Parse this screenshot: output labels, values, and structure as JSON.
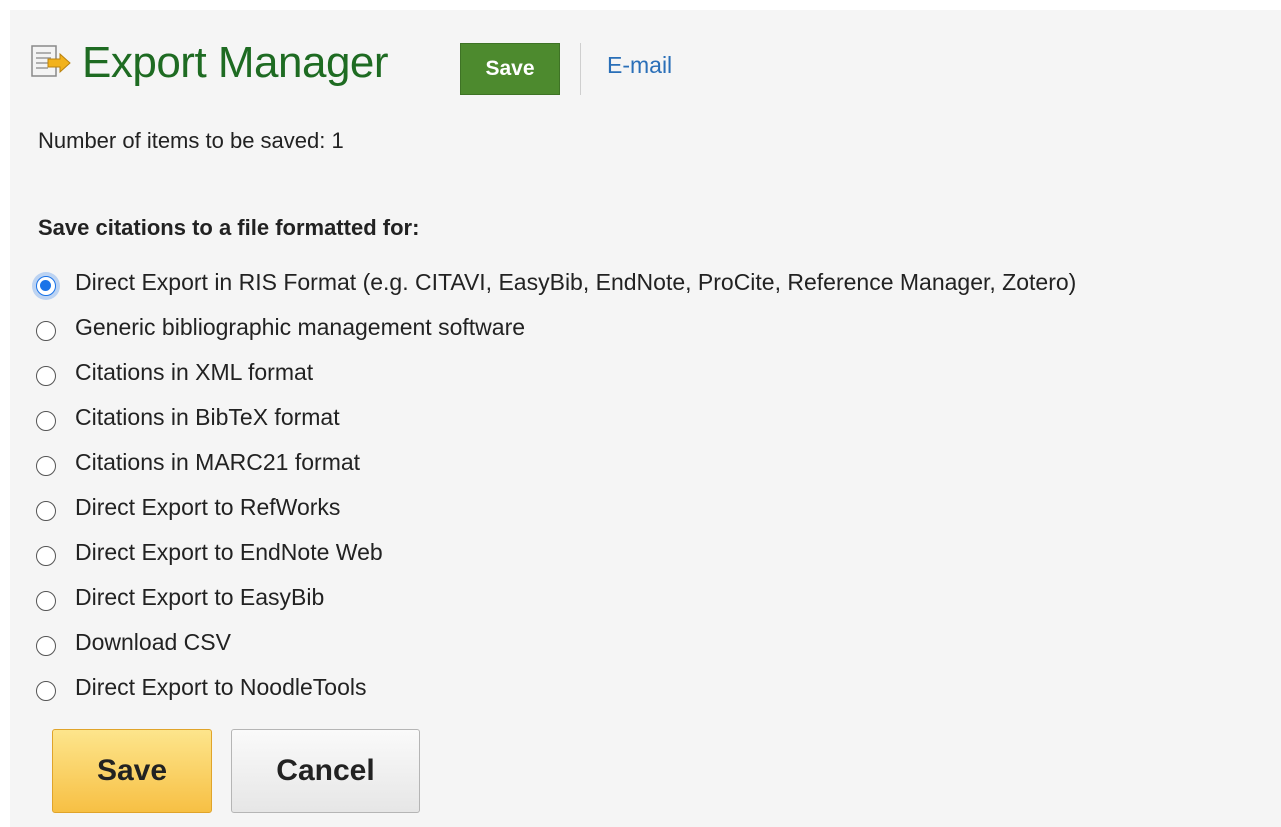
{
  "header": {
    "title": "Export Manager",
    "icon": "export-document-icon",
    "save_label": "Save",
    "email_label": "E-mail"
  },
  "count": {
    "text": "Number of items to be saved: 1"
  },
  "format": {
    "label": "Save citations to a file formatted for:",
    "selected_index": 0,
    "options": [
      {
        "label": "Direct Export in RIS Format (e.g. CITAVI, EasyBib, EndNote, ProCite, Reference Manager, Zotero)"
      },
      {
        "label": "Generic bibliographic management software"
      },
      {
        "label": "Citations in XML format"
      },
      {
        "label": "Citations in BibTeX format"
      },
      {
        "label": "Citations in MARC21 format"
      },
      {
        "label": "Direct Export to RefWorks"
      },
      {
        "label": "Direct Export to EndNote Web"
      },
      {
        "label": "Direct Export to EasyBib"
      },
      {
        "label": "Download CSV"
      },
      {
        "label": "Direct Export to NoodleTools"
      }
    ]
  },
  "actions": {
    "save_label": "Save",
    "cancel_label": "Cancel"
  },
  "colors": {
    "title": "#1e6b22",
    "save_top_bg": "#4d8a2e",
    "link": "#2a6fb8",
    "save_bg": "#f7c044",
    "radio_checked": "#1a73e8"
  }
}
